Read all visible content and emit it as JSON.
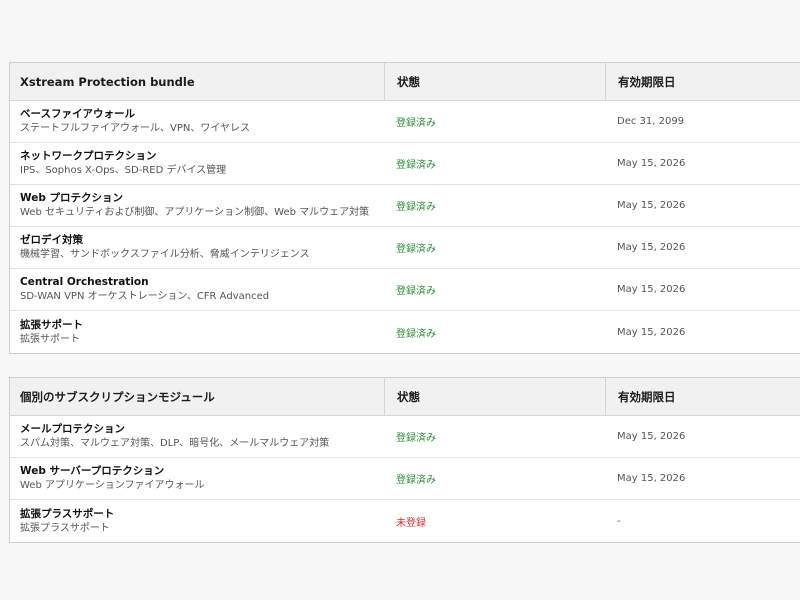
{
  "colors": {
    "registered": "#2e8b3a",
    "unregistered": "#d32f2f"
  },
  "bundle": {
    "header": {
      "name": "Xstream Protection bundle",
      "status": "状態",
      "expiry": "有効期限日"
    },
    "rows": [
      {
        "name": "ベースファイアウォール",
        "desc": "ステートフルファイアウォール、VPN、ワイヤレス",
        "status": "登録済み",
        "expiry": "Dec 31, 2099"
      },
      {
        "name": "ネットワークプロテクション",
        "desc": "IPS、Sophos X-Ops、SD-RED デバイス管理",
        "status": "登録済み",
        "expiry": "May 15, 2026"
      },
      {
        "name": "Web プロテクション",
        "desc": "Web セキュリティおよび制御、アプリケーション制御、Web マルウェア対策",
        "status": "登録済み",
        "expiry": "May 15, 2026"
      },
      {
        "name": "ゼロデイ対策",
        "desc": "機械学習、サンドボックスファイル分析、脅威インテリジェンス",
        "status": "登録済み",
        "expiry": "May 15, 2026"
      },
      {
        "name": "Central Orchestration",
        "desc": "SD-WAN VPN オーケストレーション、CFR Advanced",
        "status": "登録済み",
        "expiry": "May 15, 2026"
      },
      {
        "name": "拡張サポート",
        "desc": "拡張サポート",
        "status": "登録済み",
        "expiry": "May 15, 2026"
      }
    ]
  },
  "modules": {
    "header": {
      "name": "個別のサブスクリプションモジュール",
      "status": "状態",
      "expiry": "有効期限日"
    },
    "rows": [
      {
        "name": "メールプロテクション",
        "desc": "スパム対策、マルウェア対策、DLP、暗号化、メールマルウェア対策",
        "status": "登録済み",
        "expiry": "May 15, 2026"
      },
      {
        "name": "Web サーバープロテクション",
        "desc": "Web アプリケーションファイアウォール",
        "status": "登録済み",
        "expiry": "May 15, 2026"
      },
      {
        "name": "拡張プラスサポート",
        "desc": "拡張プラスサポート",
        "status": "未登録",
        "expiry": "-"
      }
    ]
  }
}
